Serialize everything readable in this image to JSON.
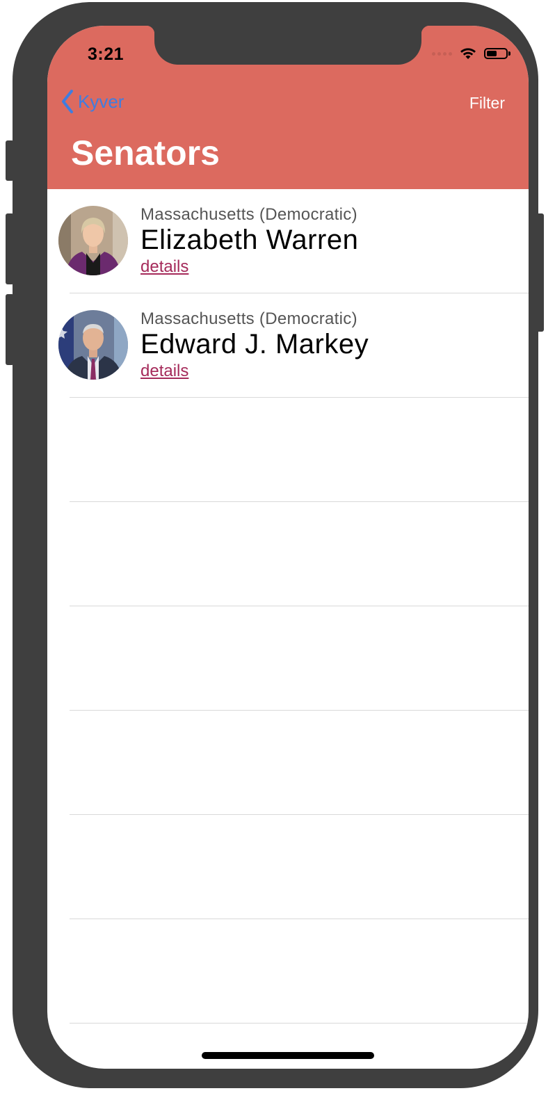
{
  "status_bar": {
    "time": "3:21"
  },
  "nav": {
    "back_label": "Kyver",
    "filter_label": "Filter",
    "title": "Senators"
  },
  "senators": [
    {
      "state_party": "Massachusetts (Democratic)",
      "name": "Elizabeth Warren",
      "details_label": "details"
    },
    {
      "state_party": "Massachusetts (Democratic)",
      "name": "Edward J. Markey",
      "details_label": "details"
    }
  ],
  "colors": {
    "header_bg": "#dc6a5f",
    "back_tint": "#3f7de0",
    "link": "#a52a5a",
    "phone_frame": "#3f3f3f"
  },
  "icons": {
    "back": "chevron-left-icon",
    "wifi": "wifi-icon",
    "battery": "battery-icon",
    "signal": "cellular-signal-icon"
  }
}
